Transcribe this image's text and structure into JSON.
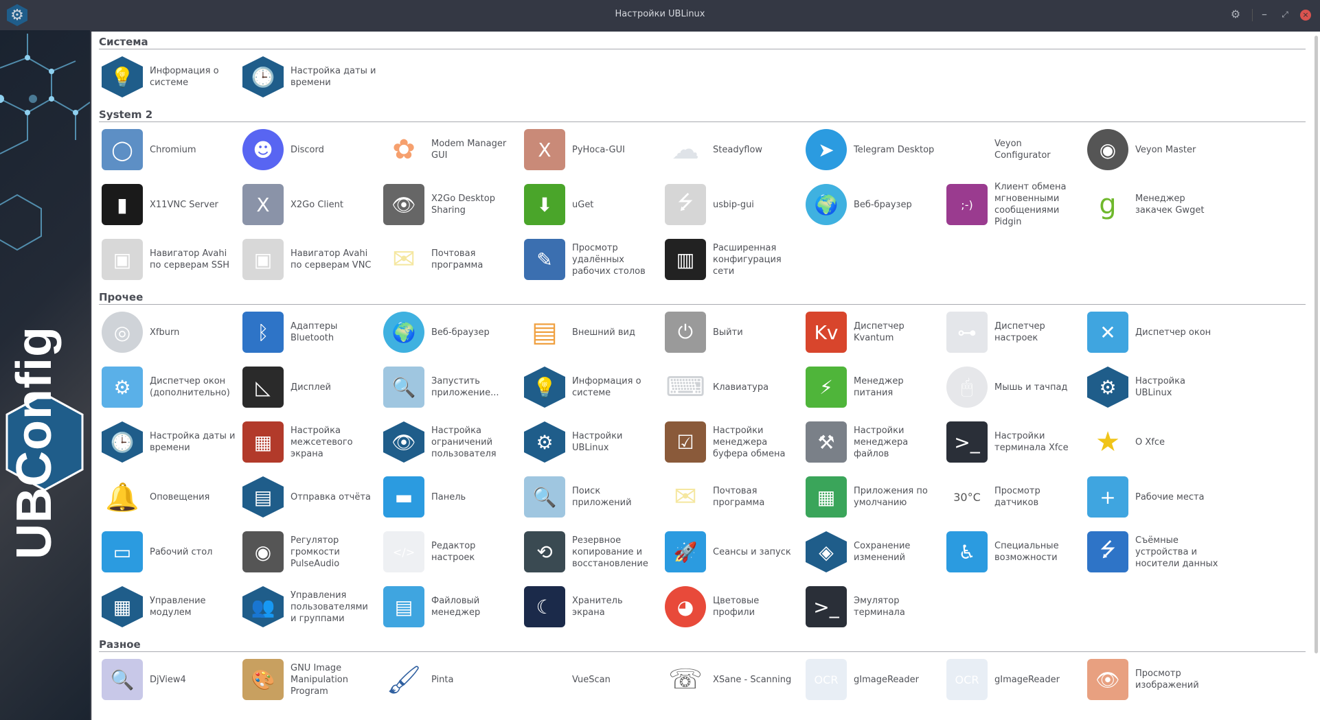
{
  "window": {
    "title": "Настройки UBLinux",
    "brand": "UBConfig",
    "app_icon": "gear-icon",
    "settings_icon": "gear-icon",
    "minimize": "–",
    "maximize": "⤢",
    "close": "×"
  },
  "sections": [
    {
      "title": "Система",
      "items": [
        {
          "label": "Информация о системе",
          "icon": "info-icon",
          "shape": "hex",
          "color": "#1f5d8a",
          "glyph": "💡"
        },
        {
          "label": "Настройка даты и времени",
          "icon": "clock-icon",
          "shape": "hex",
          "color": "#1f5d8a",
          "glyph": "🕒"
        }
      ]
    },
    {
      "title": "System 2",
      "items": [
        {
          "label": "Chromium",
          "icon": "chromium-icon",
          "shape": "sq",
          "color": "#5d8fc5",
          "glyph": "◯"
        },
        {
          "label": "Discord",
          "icon": "discord-icon",
          "shape": "round",
          "color": "#5865f2",
          "glyph": "☻"
        },
        {
          "label": "Modem Manager GUI",
          "icon": "lotus-icon",
          "shape": "none",
          "color": "#f6a06e",
          "glyph": "✿"
        },
        {
          "label": "PyHoca-GUI",
          "icon": "x-icon",
          "shape": "sq",
          "color": "#c98a78",
          "glyph": "X"
        },
        {
          "label": "Steadyflow",
          "icon": "cloud-download-icon",
          "shape": "none",
          "color": "#dfe3e8",
          "glyph": "☁"
        },
        {
          "label": "Telegram Desktop",
          "icon": "telegram-icon",
          "shape": "round",
          "color": "#2b9be0",
          "glyph": "➤"
        },
        {
          "label": "Veyon Configurator",
          "icon": "sliders-icon",
          "shape": "none",
          "color": "#fff",
          "glyph": "⊸"
        },
        {
          "label": "Veyon Master",
          "icon": "eye-icon",
          "shape": "round",
          "color": "#555",
          "glyph": "◉"
        },
        {
          "label": "X11VNC Server",
          "icon": "tablet-icon",
          "shape": "sq",
          "color": "#1a1a1a",
          "glyph": "▮"
        },
        {
          "label": "X2Go Client",
          "icon": "x2go-icon",
          "shape": "sq",
          "color": "#8a93a8",
          "glyph": "X"
        },
        {
          "label": "X2Go Desktop Sharing",
          "icon": "x2go-eye-icon",
          "shape": "sq",
          "color": "#666",
          "glyph": "👁"
        },
        {
          "label": "uGet",
          "icon": "uget-icon",
          "shape": "sq",
          "color": "#4aa52a",
          "glyph": "⬇"
        },
        {
          "label": "usbip-gui",
          "icon": "usb-drive-icon",
          "shape": "sq",
          "color": "#d6d6d6",
          "glyph": "⭍"
        },
        {
          "label": "Веб-браузер",
          "icon": "globe-icon",
          "shape": "round",
          "color": "#3fb1e0",
          "glyph": "🌍"
        },
        {
          "label": "Клиент обмена мгновенными сообщениями Pidgin",
          "icon": "pidgin-icon",
          "shape": "sq",
          "color": "#9a3b8f",
          "glyph": ";-)"
        },
        {
          "label": "Менеджер закачек Gwget",
          "icon": "gwget-icon",
          "shape": "none",
          "color": "#6fb82c",
          "glyph": "g"
        },
        {
          "label": "Навигатор Avahi по серверам SSH",
          "icon": "network-port-icon",
          "shape": "sq",
          "color": "#d8d8d8",
          "glyph": "▣"
        },
        {
          "label": "Навигатор Avahi по серверам VNC",
          "icon": "network-port-icon",
          "shape": "sq",
          "color": "#d8d8d8",
          "glyph": "▣"
        },
        {
          "label": "Почтовая программа",
          "icon": "mail-icon",
          "shape": "none",
          "color": "#f5e7a0",
          "glyph": "✉"
        },
        {
          "label": "Просмотр удалённых рабочих столов",
          "icon": "remote-desktop-icon",
          "shape": "sq",
          "color": "#3b6fb0",
          "glyph": "✎"
        },
        {
          "label": "Расширенная конфигурация сети",
          "icon": "network-config-icon",
          "shape": "sq",
          "color": "#222",
          "glyph": "▥"
        }
      ]
    },
    {
      "title": "Прочее",
      "items": [
        {
          "label": "Xfburn",
          "icon": "disc-icon",
          "shape": "round",
          "color": "#cfd3d8",
          "glyph": "◎"
        },
        {
          "label": "Адаптеры Bluetooth",
          "icon": "bluetooth-icon",
          "shape": "sq",
          "color": "#2e74c7",
          "glyph": "ᛒ"
        },
        {
          "label": "Веб-браузер",
          "icon": "globe-icon",
          "shape": "round",
          "color": "#3fb1e0",
          "glyph": "🌍"
        },
        {
          "label": "Внешний вид",
          "icon": "palette-icon",
          "shape": "none",
          "color": "#f0a040",
          "glyph": "▤"
        },
        {
          "label": "Выйти",
          "icon": "logout-icon",
          "shape": "sq",
          "color": "#9a9a9a",
          "glyph": "⏻"
        },
        {
          "label": "Диспетчер Kvantum",
          "icon": "kvantum-icon",
          "shape": "sq",
          "color": "#d8452c",
          "glyph": "Kv"
        },
        {
          "label": "Диспетчер настроек",
          "icon": "toggles-icon",
          "shape": "sq",
          "color": "#e4e6ea",
          "glyph": "⊶"
        },
        {
          "label": "Диспетчер окон",
          "icon": "window-manager-icon",
          "shape": "sq",
          "color": "#3fa5e0",
          "glyph": "✕"
        },
        {
          "label": "Диспетчер окон (дополнительно)",
          "icon": "window-gear-icon",
          "shape": "sq",
          "color": "#5ab0e8",
          "glyph": "⚙"
        },
        {
          "label": "Дисплей",
          "icon": "display-icon",
          "shape": "sq",
          "color": "#2a2a2a",
          "glyph": "◺"
        },
        {
          "label": "Запустить приложение...",
          "icon": "run-app-icon",
          "shape": "sq",
          "color": "#9fc6e0",
          "glyph": "🔍"
        },
        {
          "label": "Информация о системе",
          "icon": "info-icon",
          "shape": "hex",
          "color": "#1f5d8a",
          "glyph": "💡"
        },
        {
          "label": "Клавиатура",
          "icon": "keyboard-icon",
          "shape": "none",
          "color": "#cfd2d6",
          "glyph": "⌨"
        },
        {
          "label": "Менеджер питания",
          "icon": "battery-icon",
          "shape": "sq",
          "color": "#4fb53a",
          "glyph": "⚡"
        },
        {
          "label": "Мышь и тачпад",
          "icon": "mouse-icon",
          "shape": "round",
          "color": "#e6e7ea",
          "glyph": "🖱"
        },
        {
          "label": "Настройка UBLinux",
          "icon": "gear-icon",
          "shape": "hex",
          "color": "#1f5d8a",
          "glyph": "⚙"
        },
        {
          "label": "Настройка даты и времени",
          "icon": "clock-icon",
          "shape": "hex",
          "color": "#1f5d8a",
          "glyph": "🕒"
        },
        {
          "label": "Настройка межсетевого экрана",
          "icon": "firewall-icon",
          "shape": "sq",
          "color": "#b23a2a",
          "glyph": "▦"
        },
        {
          "label": "Настройка ограничений пользователя",
          "icon": "user-restrictions-icon",
          "shape": "hex",
          "color": "#1f5d8a",
          "glyph": "👁"
        },
        {
          "label": "Настройки UBLinux",
          "icon": "gear-icon",
          "shape": "hex",
          "color": "#1f5d8a",
          "glyph": "⚙"
        },
        {
          "label": "Настройки менеджера буфера обмена",
          "icon": "clipboard-icon",
          "shape": "sq",
          "color": "#8a5a3a",
          "glyph": "☑"
        },
        {
          "label": "Настройки менеджера файлов",
          "icon": "file-manager-settings-icon",
          "shape": "sq",
          "color": "#7a8088",
          "glyph": "⚒"
        },
        {
          "label": "Настройки терминала Xfce",
          "icon": "terminal-settings-icon",
          "shape": "sq",
          "color": "#2a2f38",
          "glyph": ">_"
        },
        {
          "label": "О Xfce",
          "icon": "star-icon",
          "shape": "none",
          "color": "#f0c419",
          "glyph": "★"
        },
        {
          "label": "Оповещения",
          "icon": "bell-icon",
          "shape": "none",
          "color": "#f0b400",
          "glyph": "🔔"
        },
        {
          "label": "Отправка отчёта",
          "icon": "report-icon",
          "shape": "hex",
          "color": "#1f5d8a",
          "glyph": "▤"
        },
        {
          "label": "Панель",
          "icon": "panel-icon",
          "shape": "sq",
          "color": "#2b9be0",
          "glyph": "▬"
        },
        {
          "label": "Поиск приложений",
          "icon": "app-search-icon",
          "shape": "sq",
          "color": "#9fc6e0",
          "glyph": "🔍"
        },
        {
          "label": "Почтовая программа",
          "icon": "mail-icon",
          "shape": "none",
          "color": "#f5e7a0",
          "glyph": "✉"
        },
        {
          "label": "Приложения по умолчанию",
          "icon": "default-apps-icon",
          "shape": "sq",
          "color": "#3aa55a",
          "glyph": "▦"
        },
        {
          "label": "Просмотр датчиков",
          "icon": "sensors-icon",
          "shape": "none",
          "color": "#555",
          "glyph": "30°C"
        },
        {
          "label": "Рабочие места",
          "icon": "workspaces-icon",
          "shape": "sq",
          "color": "#3fa5e0",
          "glyph": "+"
        },
        {
          "label": "Рабочий стол",
          "icon": "desktop-icon",
          "shape": "sq",
          "color": "#2b9be0",
          "glyph": "▭"
        },
        {
          "label": "Регулятор громкости PulseAudio",
          "icon": "speaker-icon",
          "shape": "sq",
          "color": "#555",
          "glyph": "◉"
        },
        {
          "label": "Редактор настроек",
          "icon": "settings-editor-icon",
          "shape": "sq",
          "color": "#eef0f3",
          "glyph": "</>"
        },
        {
          "label": "Резервное копирование и восстановление",
          "icon": "backup-icon",
          "shape": "sq",
          "color": "#3a4a52",
          "glyph": "⟲"
        },
        {
          "label": "Сеансы и запуск",
          "icon": "rocket-icon",
          "shape": "sq",
          "color": "#2b9be0",
          "glyph": "🚀"
        },
        {
          "label": "Сохранение изменений",
          "icon": "save-changes-icon",
          "shape": "hex",
          "color": "#1f5d8a",
          "glyph": "◈"
        },
        {
          "label": "Специальные возможности",
          "icon": "accessibility-icon",
          "shape": "sq",
          "color": "#2b9be0",
          "glyph": "♿"
        },
        {
          "label": "Съёмные устройства и носители данных",
          "icon": "usb-icon",
          "shape": "sq",
          "color": "#2e74c7",
          "glyph": "⭍"
        },
        {
          "label": "Управление модулем",
          "icon": "modules-icon",
          "shape": "hex",
          "color": "#1f5d8a",
          "glyph": "▦"
        },
        {
          "label": "Управления пользователями и группами",
          "icon": "users-icon",
          "shape": "hex",
          "color": "#1f5d8a",
          "glyph": "👥"
        },
        {
          "label": "Файловый менеджер",
          "icon": "file-cabinet-icon",
          "shape": "sq",
          "color": "#3fa5e0",
          "glyph": "▤"
        },
        {
          "label": "Хранитель экрана",
          "icon": "screensaver-icon",
          "shape": "sq",
          "color": "#1b2a4a",
          "glyph": "☾"
        },
        {
          "label": "Цветовые профили",
          "icon": "color-profiles-icon",
          "shape": "round",
          "color": "#e84a3a",
          "glyph": "◕"
        },
        {
          "label": "Эмулятор терминала",
          "icon": "terminal-icon",
          "shape": "sq",
          "color": "#2a2f38",
          "glyph": ">_"
        }
      ]
    },
    {
      "title": "Разное",
      "items": [
        {
          "label": "DjView4",
          "icon": "djview-icon",
          "shape": "sq",
          "color": "#c8c8e8",
          "glyph": "🔍"
        },
        {
          "label": "GNU Image Manipulation Program",
          "icon": "gimp-icon",
          "shape": "sq",
          "color": "#c8a060",
          "glyph": "🎨"
        },
        {
          "label": "Pinta",
          "icon": "pinta-icon",
          "shape": "none",
          "color": "#3060a0",
          "glyph": "🖌"
        },
        {
          "label": "VueScan",
          "icon": "vuescan-icon",
          "shape": "none",
          "color": "#fff",
          "glyph": ""
        },
        {
          "label": "XSane - Scanning",
          "icon": "xsane-icon",
          "shape": "none",
          "color": "#666",
          "glyph": "☏"
        },
        {
          "label": "gImageReader",
          "icon": "ocr-icon",
          "shape": "sq",
          "color": "#e8eef5",
          "glyph": "OCR"
        },
        {
          "label": "gImageReader",
          "icon": "ocr-icon",
          "shape": "sq",
          "color": "#e8eef5",
          "glyph": "OCR"
        },
        {
          "label": "Просмотр изображений",
          "icon": "image-viewer-icon",
          "shape": "sq",
          "color": "#e8a080",
          "glyph": "👁"
        }
      ]
    }
  ]
}
